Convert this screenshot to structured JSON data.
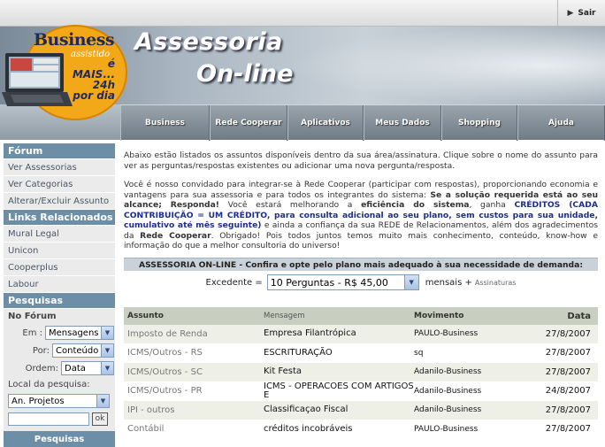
{
  "topbar": {
    "logout_label": "Sair"
  },
  "banner": {
    "title_line1": "Assessoria",
    "title_line2": "On-line",
    "logo_brand": "Business",
    "logo_sub": "assistido",
    "logo_tagline1": "é MAIS...",
    "logo_tagline2": "24h",
    "logo_tagline3": "por dia"
  },
  "nav": {
    "tabs": [
      {
        "label": "Business"
      },
      {
        "label": "Rede Cooperar"
      },
      {
        "label": "Aplicativos"
      },
      {
        "label": "Meus Dados"
      },
      {
        "label": "Shopping"
      },
      {
        "label": "Ajuda"
      }
    ]
  },
  "sidebar": {
    "forum_title": "Fórum",
    "forum_items": [
      "Ver Assessorias",
      "Ver Categorias",
      "Alterar/Excluir Assunto"
    ],
    "links_title": "Links Relacionados",
    "links_items": [
      "Mural Legal",
      "Unicon",
      "Cooperplus",
      "Labour"
    ],
    "search_title": "Pesquisas",
    "no_forum_label": "No Fórum",
    "em_label": "Em :",
    "em_value": "Mensagens",
    "por_label": "Por:",
    "por_value": "Conteúdo",
    "ordem_label": "Ordem:",
    "ordem_value": "Data",
    "local_label": "Local da pesquisa:",
    "local_value": "An. Projetos",
    "search_value": "",
    "ok_label": "ok",
    "bottom_label": "Pesquisas"
  },
  "intro": {
    "p1": "Abaixo estão listados os assuntos disponíveis dentro da sua área/assinatura. Clique sobre o nome do assunto para ver as perguntas/respostas existentes ou adicionar uma nova pergunta/resposta.",
    "p2_a": "Você é nosso convidado para integrar-se à Rede Cooperar (participar com respostas), proporcionando economia e vantagens para sua assessoria e para todos os integrantes do sistema: ",
    "p2_b": "Se a solução requerida está ao seu alcance; Responda!",
    "p2_c": " Você estará melhorando a ",
    "p2_d": "eficiência do sistema",
    "p2_e": ", ganha ",
    "p2_f": "CRÉDITOS (CADA CONTRIBUIÇÃO = UM CRÉDITO, para consulta adicional ao seu plano, sem custos para sua unidade, cumulativo até mês seguinte)",
    "p2_g": " e ainda a confiança da sua REDE de Relacionamentos, além dos agradecimentos da ",
    "p2_h": "Rede Cooperar",
    "p2_i": ". Obrigado! Pois todos juntos temos muito mais conhecimento, conteúdo, know-how e informação do que a melhor consultoria do universo!"
  },
  "plan": {
    "bar_text": "ASSESSORIA ON-LINE - Confira e opte pelo plano mais adequado à sua necessidade de demanda:",
    "excedente_label": "Excedente =",
    "excedente_value": "10 Perguntas - R$ 45,00",
    "mensais_label": "mensais +",
    "assinaturas_label": "Assinaturas"
  },
  "table": {
    "headers": {
      "assunto": "Assunto",
      "mensagem": "Mensagem",
      "movimento": "Movimento",
      "data": "Data"
    },
    "rows": [
      {
        "assunto": "Imposto de Renda",
        "mensagem": "Empresa Filantrópica",
        "movimento": "PAULO-Business",
        "data": "27/8/2007"
      },
      {
        "assunto": "ICMS/Outros - RS",
        "mensagem": "ESCRITURAÇÃO",
        "movimento": "sq",
        "data": "27/8/2007"
      },
      {
        "assunto": "ICMS/Outros - SC",
        "mensagem": "Kit Festa",
        "movimento": "Adanilo-Business",
        "data": "27/8/2007"
      },
      {
        "assunto": "ICMS/Outros - PR",
        "mensagem": "ICMS - OPERACOES COM ARTIGOS E",
        "movimento": "Adanilo-Business",
        "data": "24/8/2007"
      },
      {
        "assunto": "IPI - outros",
        "mensagem": "Classificaçao Fiscal",
        "movimento": "Adanilo-Business",
        "data": "27/8/2007"
      },
      {
        "assunto": "Contábil",
        "mensagem": "créditos incobráveis",
        "movimento": "PAULO-Business",
        "data": "27/8/2007"
      }
    ]
  },
  "colors": {
    "sidebar_head": "#6d8ea7",
    "link_blue": "#1d2e8c",
    "logo_orange": "#f3a81a"
  }
}
